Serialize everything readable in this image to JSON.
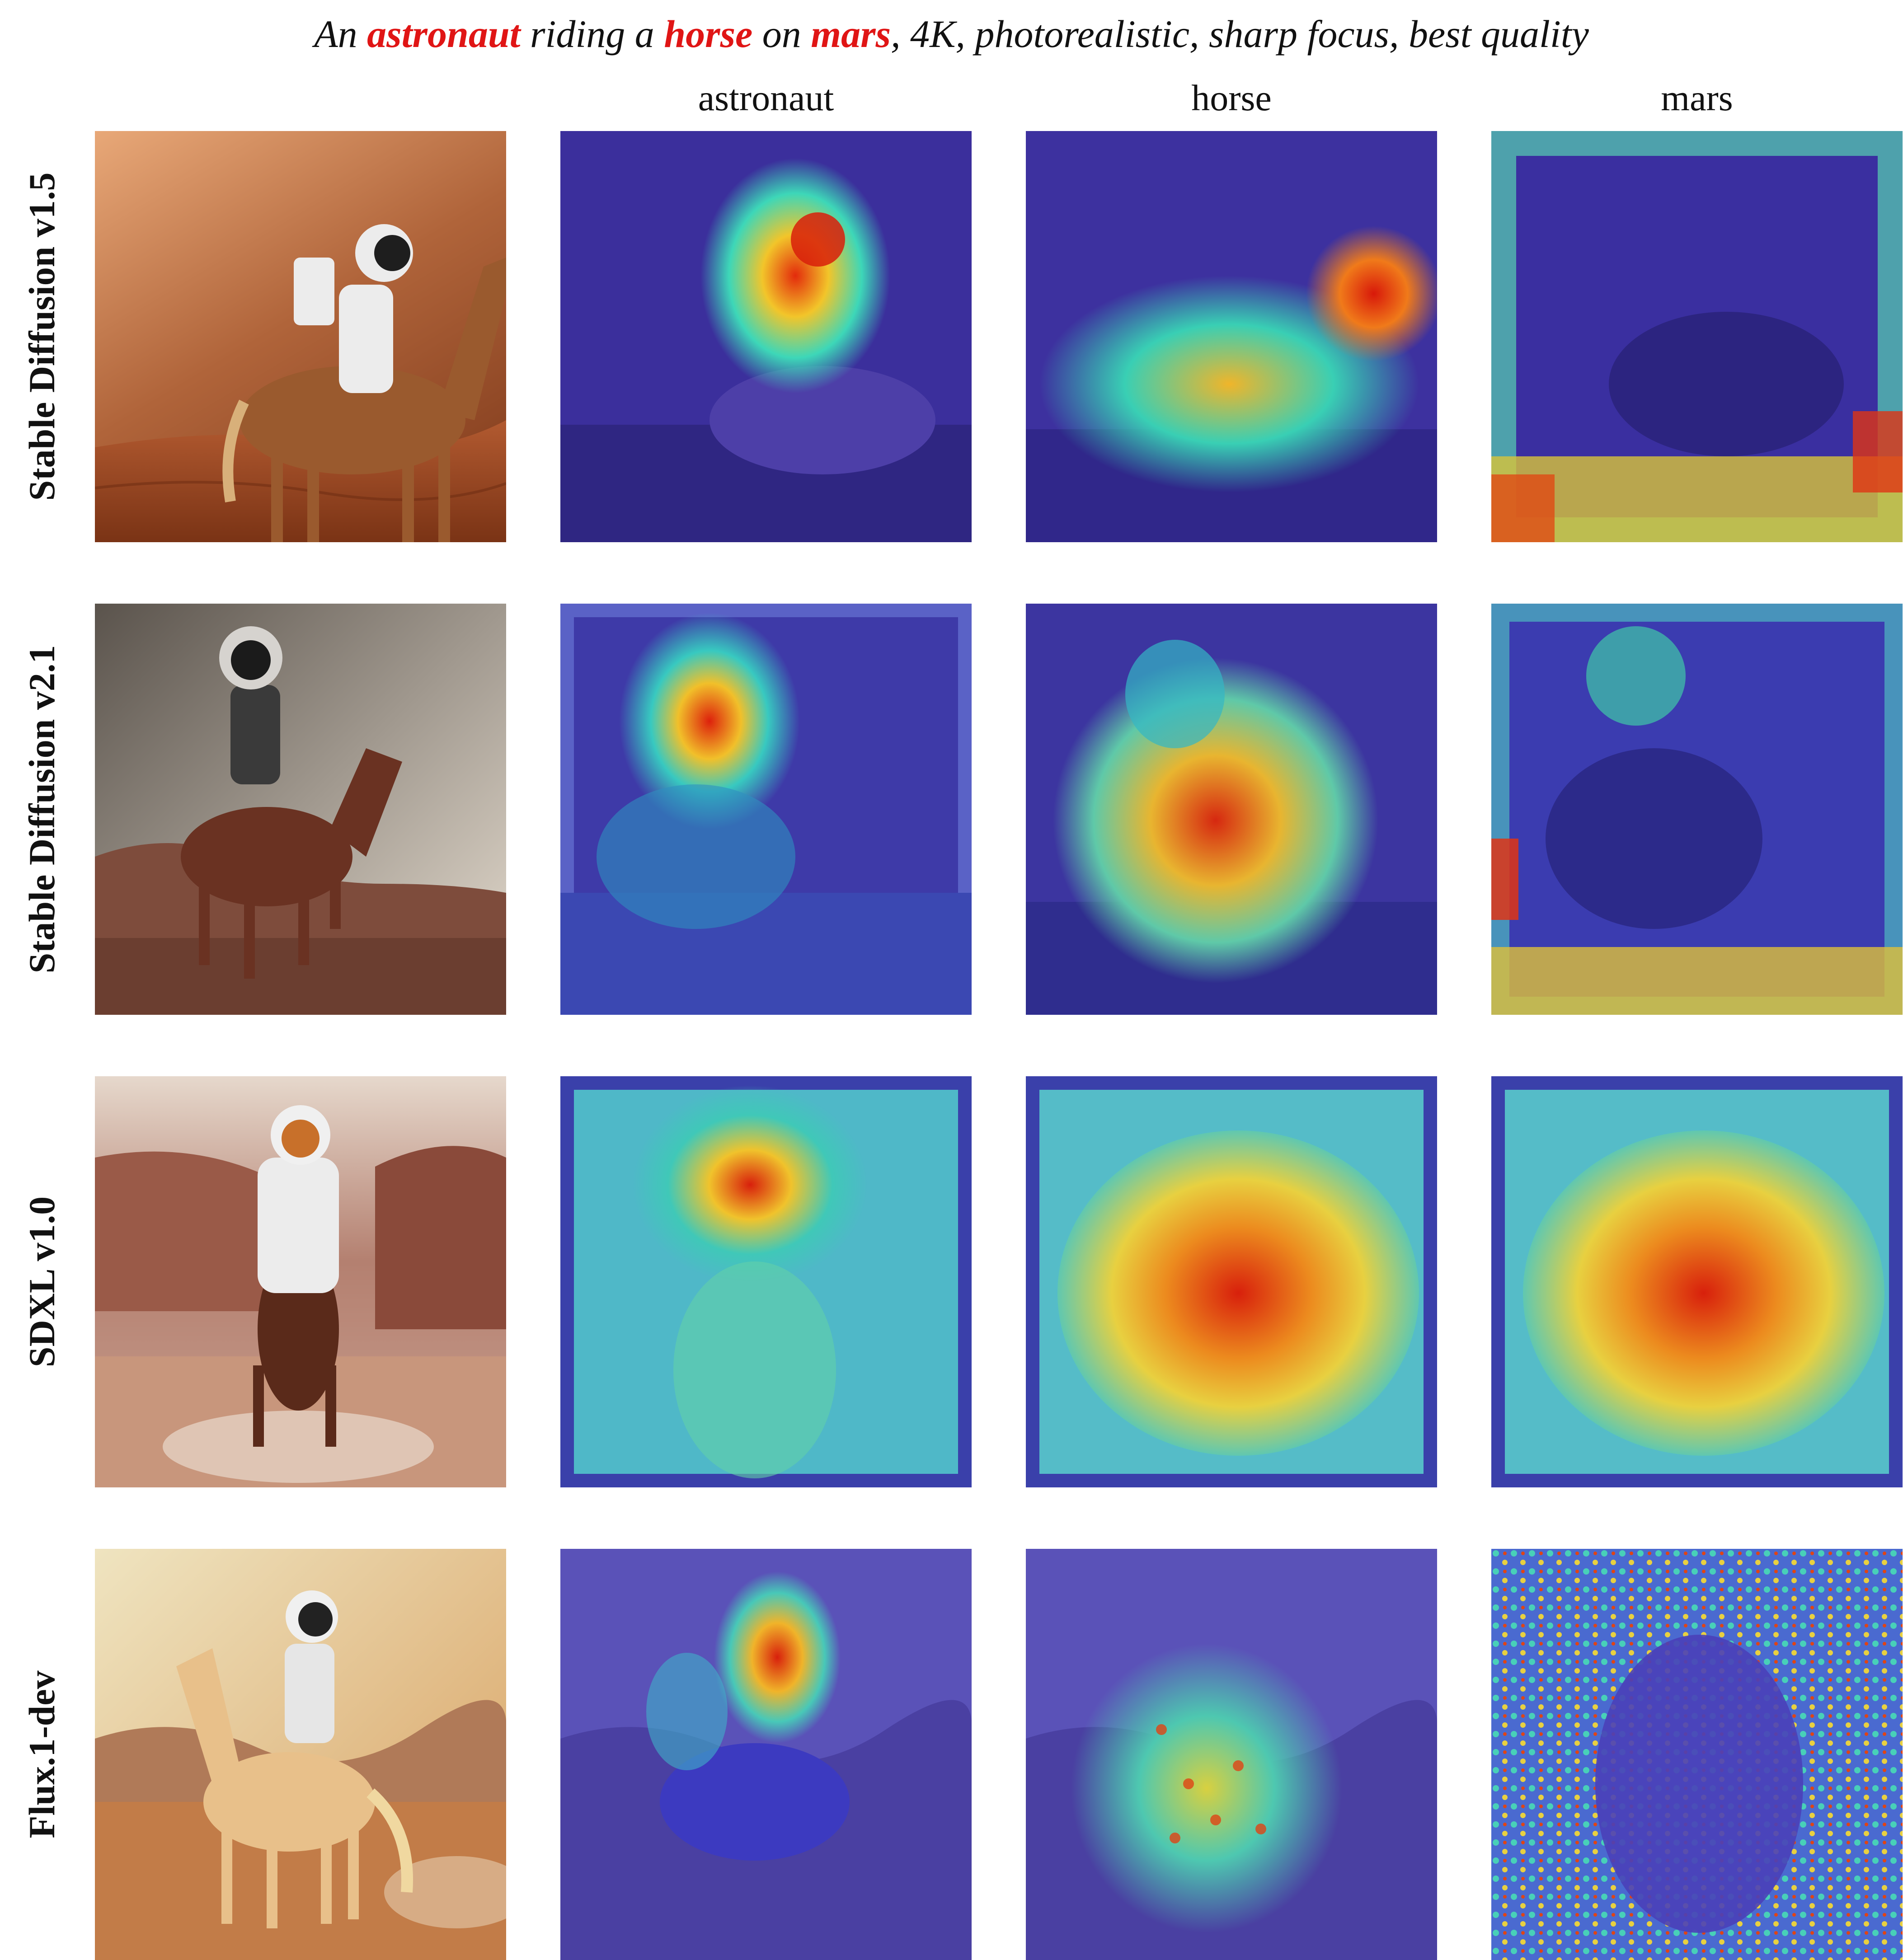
{
  "figure": {
    "prompt": {
      "p1": "An ",
      "k1": "astronaut",
      "p2": " riding a ",
      "k2": "horse",
      "p3": " on ",
      "k3": "mars",
      "p4": ", 4K, photorealistic, sharp focus, best quality"
    },
    "columns": [
      "astronaut",
      "horse",
      "mars"
    ],
    "rows": [
      "Stable Diffusion v1.5",
      "Stable Diffusion v2.1",
      "SDXL v1.0",
      "Flux.1-dev"
    ]
  },
  "colors": {
    "keyword": "#e01515",
    "heat_low": "#3a2fb0",
    "heat_mid": "#2fd0c0",
    "heat_high": "#e02010"
  }
}
